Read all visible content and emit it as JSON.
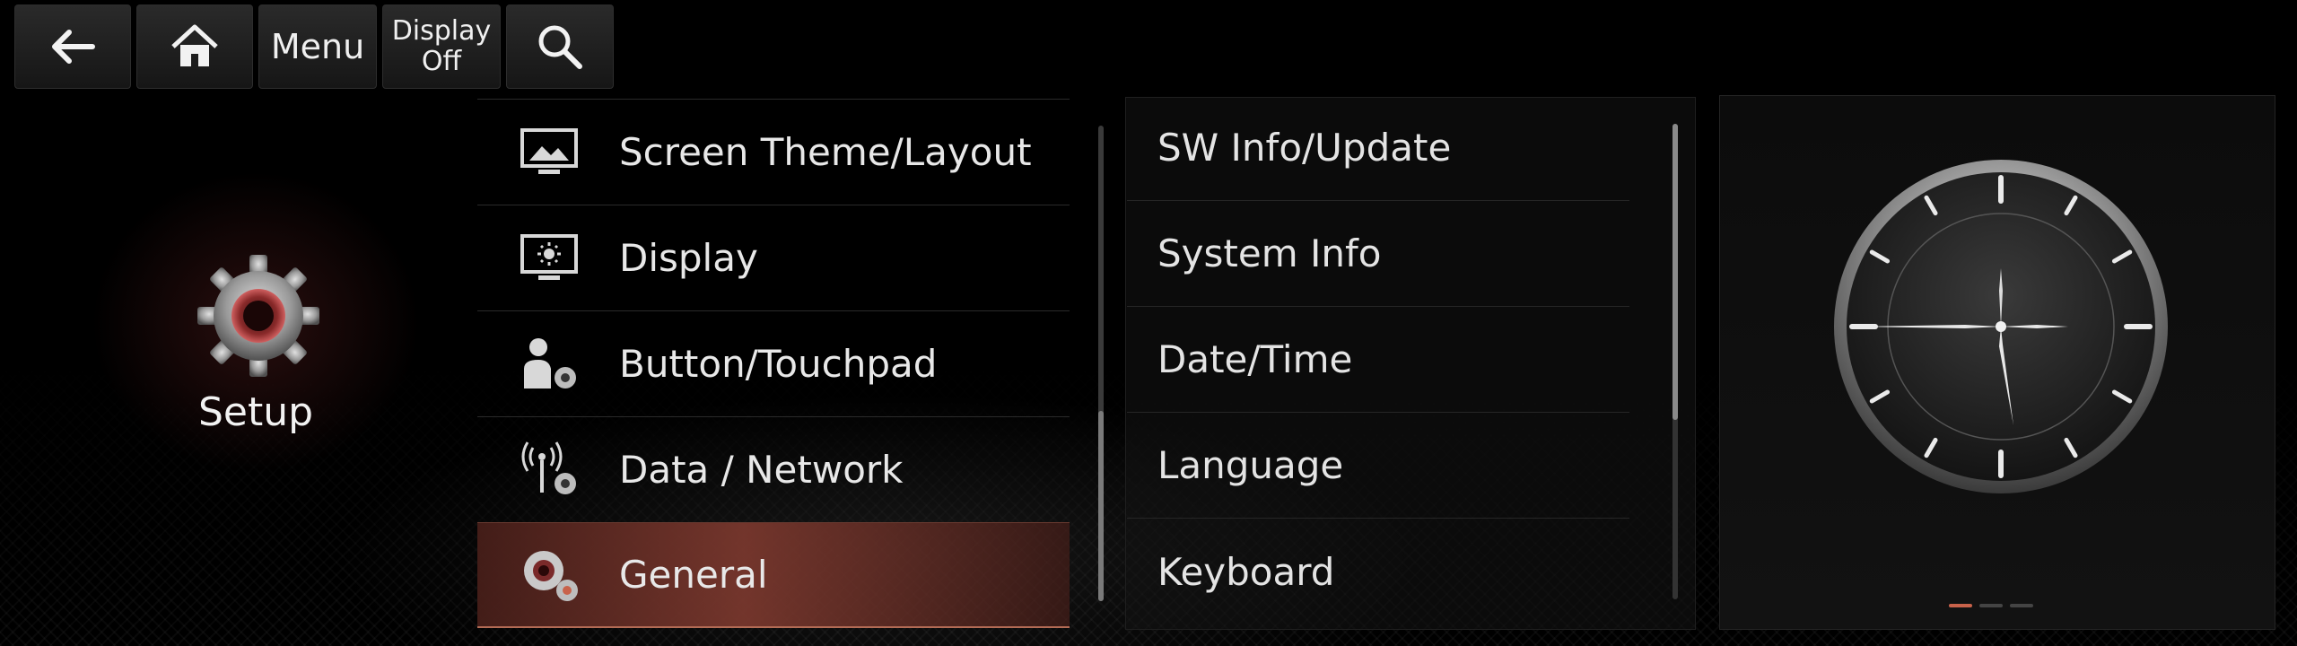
{
  "toolbar": {
    "back_icon": "back-arrow-icon",
    "home_icon": "home-icon",
    "menu_label": "Menu",
    "display_off_line1": "Display",
    "display_off_line2": "Off",
    "search_icon": "search-icon"
  },
  "setup": {
    "icon": "gear-icon",
    "label": "Setup"
  },
  "menu": {
    "items": [
      {
        "label": "Screen Theme/Layout",
        "icon": "screen-theme-icon"
      },
      {
        "label": "Display",
        "icon": "display-brightness-icon"
      },
      {
        "label": "Button/Touchpad",
        "icon": "button-touchpad-icon"
      },
      {
        "label": "Data / Network",
        "icon": "data-network-icon"
      },
      {
        "label": "General",
        "icon": "general-gear-icon",
        "selected": true
      }
    ]
  },
  "submenu": {
    "items": [
      {
        "label": "SW Info/Update"
      },
      {
        "label": "System Info"
      },
      {
        "label": "Date/Time"
      },
      {
        "label": "Language"
      },
      {
        "label": "Keyboard"
      }
    ]
  },
  "widget": {
    "type": "analog-clock",
    "page_indicator": {
      "pages": 3,
      "active": 1
    }
  },
  "colors": {
    "accent": "#c8624a",
    "background": "#000000",
    "text": "#e6e6e6"
  }
}
